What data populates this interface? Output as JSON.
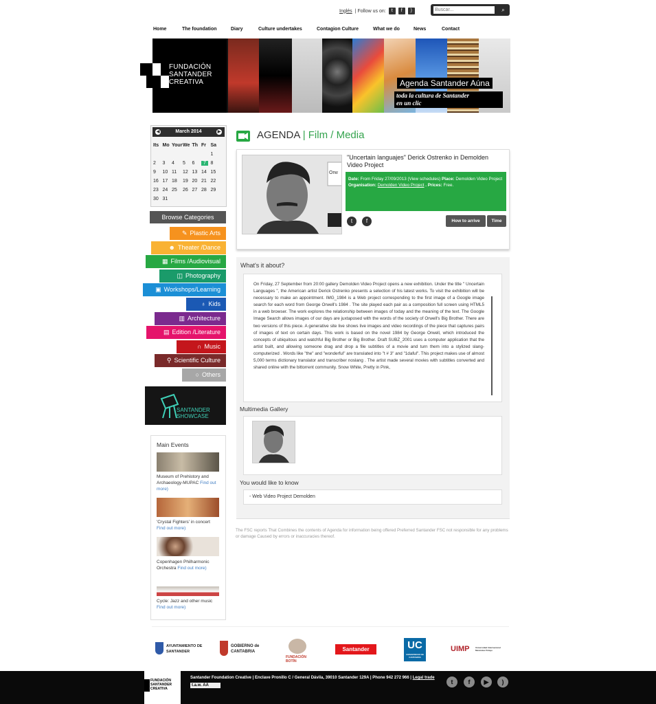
{
  "header": {
    "language_link": "Inglés",
    "follow_label": "| Follow us on:",
    "search_placeholder": "Buscar..."
  },
  "nav": [
    "Home",
    "The foundation",
    "Diary",
    "Culture undertakes",
    "Contagion Culture",
    "What we do",
    "News",
    "Contact"
  ],
  "banner": {
    "logo_lines": [
      "FUNDACIÓN",
      "SANTANDER",
      "CREATIVA"
    ],
    "agenda_title": "Agenda Santander Aúna",
    "agenda_subtitle_1": "toda la cultura de Santander",
    "agenda_subtitle_2": "en un clic"
  },
  "calendar": {
    "month": "March 2014",
    "headers": [
      "Its",
      "Mo",
      "Your",
      "We",
      "Th",
      "Fr",
      "Sa"
    ],
    "weeks": [
      [
        "",
        "",
        "",
        "",
        "",
        "",
        "1"
      ],
      [
        "2",
        "3",
        "4",
        "5",
        "6",
        "7",
        "8"
      ],
      [
        "9",
        "10",
        "11",
        "12",
        "13",
        "14",
        "15"
      ],
      [
        "16",
        "17",
        "18",
        "19",
        "20",
        "21",
        "22"
      ],
      [
        "23",
        "24",
        "25",
        "26",
        "27",
        "28",
        "29"
      ],
      [
        "30",
        "31",
        "",
        "",
        "",
        "",
        ""
      ]
    ],
    "today": "7"
  },
  "categories": {
    "title": "Browse Categories",
    "items": [
      {
        "label": "Plastic Arts",
        "icon": "brush-icon",
        "color": "#f6921e"
      },
      {
        "label": "Theater /Dance",
        "icon": "mask-icon",
        "color": "#f9b233"
      },
      {
        "label": "Films /Audiovisual",
        "icon": "film-icon",
        "color": "#27a843"
      },
      {
        "label": "Photography",
        "icon": "camera-icon",
        "color": "#1a9b6a"
      },
      {
        "label": "Workshops/Learning",
        "icon": "board-icon",
        "color": "#1b8fd6"
      },
      {
        "label": "Kids",
        "icon": "balloon-icon",
        "color": "#1b59b4"
      },
      {
        "label": "Architecture",
        "icon": "skyline-icon",
        "color": "#7b2a8e"
      },
      {
        "label": "Edition /Literature",
        "icon": "book-icon",
        "color": "#e5136b"
      },
      {
        "label": "Music",
        "icon": "headphones-icon",
        "color": "#c4161c"
      },
      {
        "label": "Scientific Culture",
        "icon": "microscope-icon",
        "color": "#7a2a2a"
      },
      {
        "label": "Others",
        "icon": "circle-icon",
        "color": "#a7a7a7"
      }
    ]
  },
  "showcase": {
    "line1": "SANTANDER",
    "line2": "SHOWCASE"
  },
  "main_events": {
    "title": "Main Events",
    "items": [
      {
        "text": "Museum of Prehistory and Archaeology-MUPAC",
        "more": "Find out more)"
      },
      {
        "text": "'Crystal Fighters' in concert",
        "more": "Find out more)"
      },
      {
        "text": "Copenhagen Philharmonic Orchestra",
        "more": "Find out more)"
      },
      {
        "text": "Cycle: Jazz and other music",
        "more": "Find out more)"
      }
    ]
  },
  "page_heading": {
    "prefix": "AGENDA",
    "section": "| Film / Media"
  },
  "event": {
    "title": "\"Uncertain languajes\" Derick Ostrenko in Demolden Video Project",
    "photo_caption": "Orw",
    "date_label": "Date:",
    "date_value": "From Friday 27/09/2013 (View schedules)",
    "place_label": "Place:",
    "place_value": "Demolden Video Project",
    "org_label": "Organisation:",
    "org_value": "Demolden Video Project",
    "prices_label": "Prices:",
    "prices_value": "Free.",
    "how_to_arrive": "How to arrive",
    "time": "Time"
  },
  "about": {
    "title": "What's it about?",
    "text": "On Friday, 27 September from 20:00 gallery Demolden Video Project opens a new exhibition. Under the title \" Uncertain Languages \", the American artist Derick Ostrenko presents a selection of his latest works. To visit the exhibition will be necessary to make an appointment. IMG_1984 is a Web project corresponding to the first image of a Google image search for each word from George Orwell's 1984 . The site played each pair as a composition full screen using HTML5 in a web browser. The work explores the relationship between images of today and the meaning of the text. The Google Image Search allows images of our days are juxtaposed with the words of the society of Orwell's Big Brother. There are two versions of this piece. A generative site live shows live images and video recordings of the piece that captures pairs of images of text on certain days. This work is based on the novel 1984 by George Orwell, which introduced the concepts of ubiquitous and watchful Big Brother or Big Brother. Draft SUBZ_2001 uses a computer application that the artist built, and allowing someone drag and drop a file subtitles of a movie and turn them into a stylized slang-computerized . Words like \"the\" and \"wonderful\" are translated into \"t # 3\" and \"1daful\". This project makes use of almost 5,000 terms dictionary translator and transcriber noslang . The artist made several movies with subtitles converted and shared online with the bittorrent community. Snow White, Pretty in Pink,"
  },
  "multimedia": {
    "title": "Multimedia Gallery"
  },
  "like": {
    "title": "You would like to know",
    "item": "- Web Video Project Demolden"
  },
  "disclaimer": "The FSC reports That Combines the contents of Agenda for information being offered Preferred Santander FSC not responsible for any problems or damage Caused by errors or inaccuracies thereof.",
  "sponsors": [
    "AYUNTAMIENTO DE SANTANDER",
    "GOBIERNO de CANTABRIA",
    "FUNDACIÓN BOTÍN",
    "Santander",
    "UC",
    "UNIVERSIDAD DE CANTABRIA",
    "UIMP",
    "Universidad Internacional Menéndez Pelayo"
  ],
  "footer": {
    "logo_lines": [
      "FUNDACIÓN",
      "SANTANDER",
      "CREATIVA"
    ],
    "info": "Santander Foundation Creative | Enclave Pronillo C / General Dávila, 39010 Santander 129A | Phone 942 272 966 |",
    "legal": "Legal trade",
    "taw": "t.a.w. AA"
  }
}
